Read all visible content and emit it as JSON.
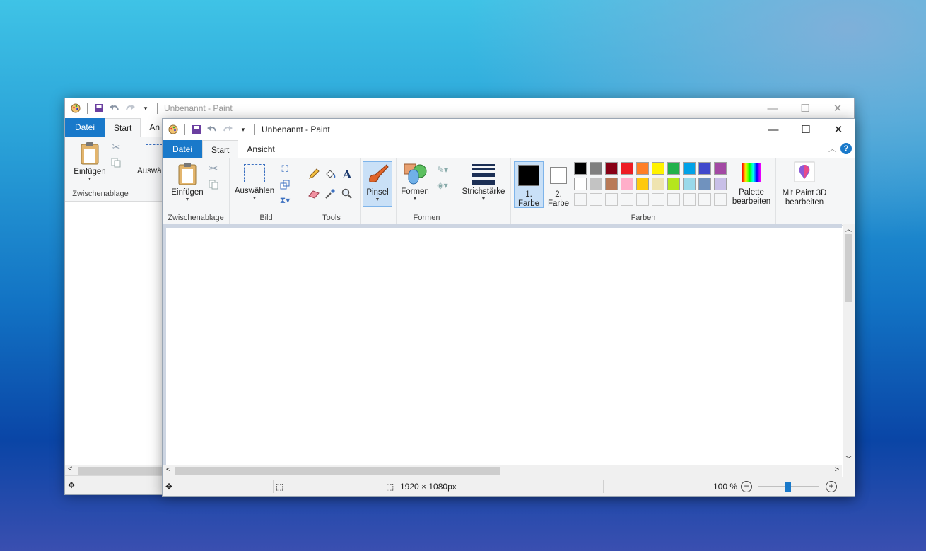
{
  "back_window": {
    "title": "Unbenannt - Paint",
    "tabs": [
      "Datei",
      "Start",
      "An"
    ],
    "paste_label": "Einfügen",
    "select_label": "Auswä",
    "group_label": "Zwischenablage"
  },
  "window": {
    "title": "Unbenannt - Paint",
    "tabs": {
      "file": "Datei",
      "start": "Start",
      "view": "Ansicht"
    },
    "help": "?",
    "groups": {
      "clipboard": {
        "label": "Zwischenablage",
        "paste": "Einfügen"
      },
      "image": {
        "label": "Bild",
        "select": "Auswählen"
      },
      "tools": {
        "label": "Tools"
      },
      "brushes": {
        "label": "Pinsel"
      },
      "shapes": {
        "label": "Formen",
        "button": "Formen"
      },
      "stroke": {
        "label": "Strichstärke"
      },
      "colors": {
        "label": "Farben",
        "color1": "1. Farbe",
        "color1_line1": "1.",
        "color1_line2": "Farbe",
        "color2_line1": "2.",
        "color2_line2": "Farbe",
        "edit_line1": "Palette",
        "edit_line2": "bearbeiten",
        "paint3d_line1": "Mit Paint 3D",
        "paint3d_line2": "bearbeiten"
      }
    },
    "palette_row1": [
      "#000000",
      "#7f7f7f",
      "#880015",
      "#ed1c24",
      "#ff7f27",
      "#fff200",
      "#22b14c",
      "#00a2e8",
      "#3f48cc",
      "#a349a4"
    ],
    "palette_row2": [
      "#ffffff",
      "#c3c3c3",
      "#b97a57",
      "#ffaec9",
      "#ffc90e",
      "#efe4b0",
      "#b5e61d",
      "#99d9ea",
      "#7092be",
      "#c8bfe7"
    ],
    "color1_value": "#000000",
    "color2_value": "#ffffff",
    "status": {
      "dimensions": "1920 × 1080px",
      "zoom": "100 %"
    }
  }
}
